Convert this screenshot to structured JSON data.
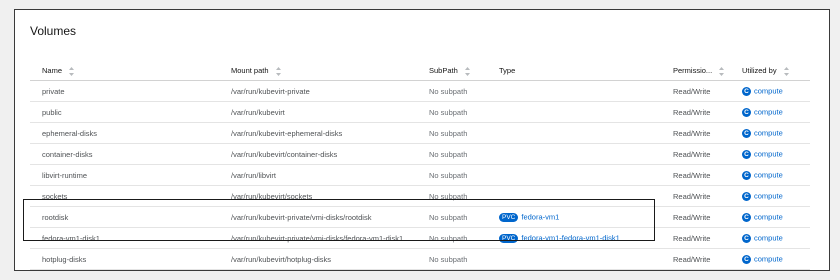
{
  "title": "Volumes",
  "columns": {
    "name": "Name",
    "mount_path": "Mount path",
    "subpath": "SubPath",
    "type": "Type",
    "permissions": "Permissio...",
    "utilized_by": "Utilized by"
  },
  "rows": [
    {
      "name": "private",
      "mount_path": "/var/run/kubevirt-private",
      "subpath": "No subpath",
      "pvc_badge": "",
      "type_link": "",
      "permissions": "Read/Write",
      "utilized_badge": "C",
      "utilized_by": "compute"
    },
    {
      "name": "public",
      "mount_path": "/var/run/kubevirt",
      "subpath": "No subpath",
      "pvc_badge": "",
      "type_link": "",
      "permissions": "Read/Write",
      "utilized_badge": "C",
      "utilized_by": "compute"
    },
    {
      "name": "ephemeral-disks",
      "mount_path": "/var/run/kubevirt-ephemeral-disks",
      "subpath": "No subpath",
      "pvc_badge": "",
      "type_link": "",
      "permissions": "Read/Write",
      "utilized_badge": "C",
      "utilized_by": "compute"
    },
    {
      "name": "container-disks",
      "mount_path": "/var/run/kubevirt/container-disks",
      "subpath": "No subpath",
      "pvc_badge": "",
      "type_link": "",
      "permissions": "Read/Write",
      "utilized_badge": "C",
      "utilized_by": "compute"
    },
    {
      "name": "libvirt-runtime",
      "mount_path": "/var/run/libvirt",
      "subpath": "No subpath",
      "pvc_badge": "",
      "type_link": "",
      "permissions": "Read/Write",
      "utilized_badge": "C",
      "utilized_by": "compute"
    },
    {
      "name": "sockets",
      "mount_path": "/var/run/kubevirt/sockets",
      "subpath": "No subpath",
      "pvc_badge": "",
      "type_link": "",
      "permissions": "Read/Write",
      "utilized_badge": "C",
      "utilized_by": "compute"
    },
    {
      "name": "rootdisk",
      "mount_path": "/var/run/kubevirt-private/vmi-disks/rootdisk",
      "subpath": "No subpath",
      "pvc_badge": "PVC",
      "type_link": "fedora-vm1",
      "permissions": "Read/Write",
      "utilized_badge": "C",
      "utilized_by": "compute"
    },
    {
      "name": "fedora-vm1-disk1",
      "mount_path": "/var/run/kubevirt-private/vmi-disks/fedora-vm1-disk1",
      "subpath": "No subpath",
      "pvc_badge": "PVC",
      "type_link": "fedora-vm1-fedora-vm1-disk1",
      "permissions": "Read/Write",
      "utilized_badge": "C",
      "utilized_by": "compute"
    },
    {
      "name": "hotplug-disks",
      "mount_path": "/var/run/kubevirt/hotplug-disks",
      "subpath": "No subpath",
      "pvc_badge": "",
      "type_link": "",
      "permissions": "Read/Write",
      "utilized_badge": "C",
      "utilized_by": "compute"
    }
  ],
  "colors": {
    "link": "#0066cc",
    "badge_bg": "#0066cc",
    "header_text": "#151515",
    "body_text": "#4f5255"
  }
}
